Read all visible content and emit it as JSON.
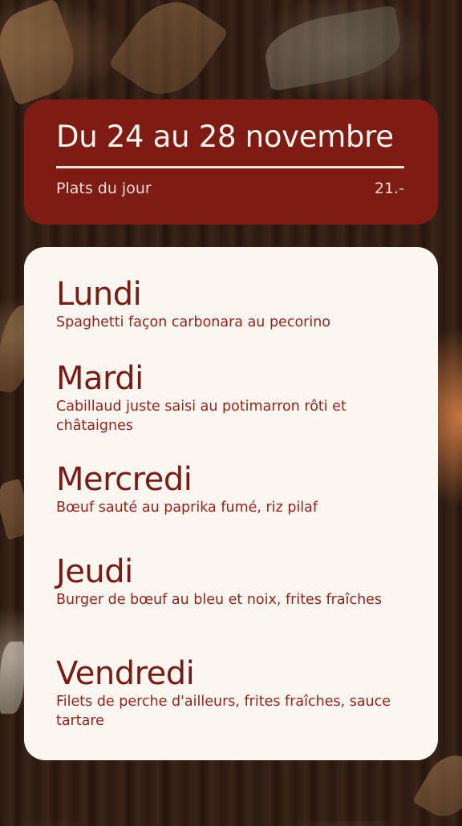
{
  "header": {
    "title": "Du 24 au 28 novembre",
    "subtitle": "Plats du jour",
    "price": "21.-"
  },
  "menu": [
    {
      "day": "Lundi",
      "dish": "Spaghetti façon carbonara au pecorino"
    },
    {
      "day": "Mardi",
      "dish": "Cabillaud juste saisi au potimarron rôti et châtaignes"
    },
    {
      "day": "Mercredi",
      "dish": "Bœuf sauté au paprika fumé, riz pilaf"
    },
    {
      "day": "Jeudi",
      "dish": "Burger de bœuf au bleu et noix, frites fraîches"
    },
    {
      "day": "Vendredi",
      "dish": "Filets de perche d'ailleurs, frites fraîches, sauce tartare"
    }
  ],
  "colors": {
    "header_bg": "#7e1c14",
    "card_bg": "#fcf6f1",
    "accent_text": "#7a1a12"
  }
}
